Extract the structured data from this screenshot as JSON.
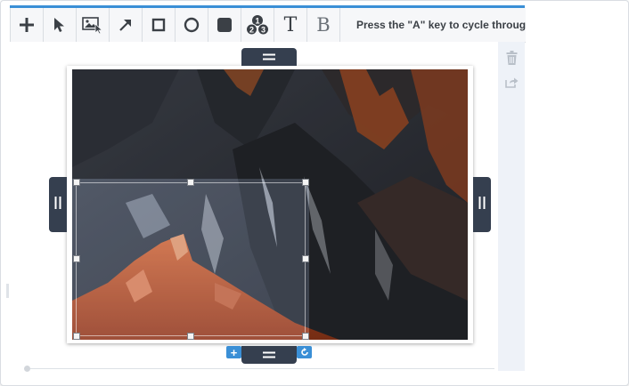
{
  "toolbar": {
    "tools": [
      {
        "name": "add-tool-button",
        "icon": "plus-icon"
      },
      {
        "name": "select-tool-button",
        "icon": "cursor-arrow-icon"
      },
      {
        "name": "image-select-tool-button",
        "icon": "image-cursor-icon"
      },
      {
        "name": "arrow-tool-button",
        "icon": "arrow-diagonal-icon"
      },
      {
        "name": "rectangle-tool-button",
        "icon": "square-outline-icon"
      },
      {
        "name": "ellipse-tool-button",
        "icon": "circle-outline-icon"
      },
      {
        "name": "filled-rectangle-tool-button",
        "icon": "square-filled-icon"
      },
      {
        "name": "numbered-steps-tool-button",
        "icon": "numbered-circles-icon"
      },
      {
        "name": "text-tool-button",
        "icon": "text-t-icon"
      },
      {
        "name": "bold-text-tool-button",
        "icon": "text-b-icon"
      }
    ],
    "text_tool_label": "T",
    "bold_tool_label": "B",
    "step_numbers": [
      "1",
      "2",
      "3"
    ],
    "hint": "Press the \"A\" key to cycle through annotation tools"
  },
  "side_panel": {
    "items": [
      {
        "name": "delete-button",
        "icon": "trash-icon"
      },
      {
        "name": "share-button",
        "icon": "share-export-icon"
      }
    ]
  },
  "canvas": {
    "image_alt": "Mountain peaks at sunset",
    "add_label": "+",
    "rotate_label": "↻"
  },
  "colors": {
    "accent": "#3a8fd6",
    "handle_tab": "#353f4f",
    "panel": "#eef2f8"
  }
}
